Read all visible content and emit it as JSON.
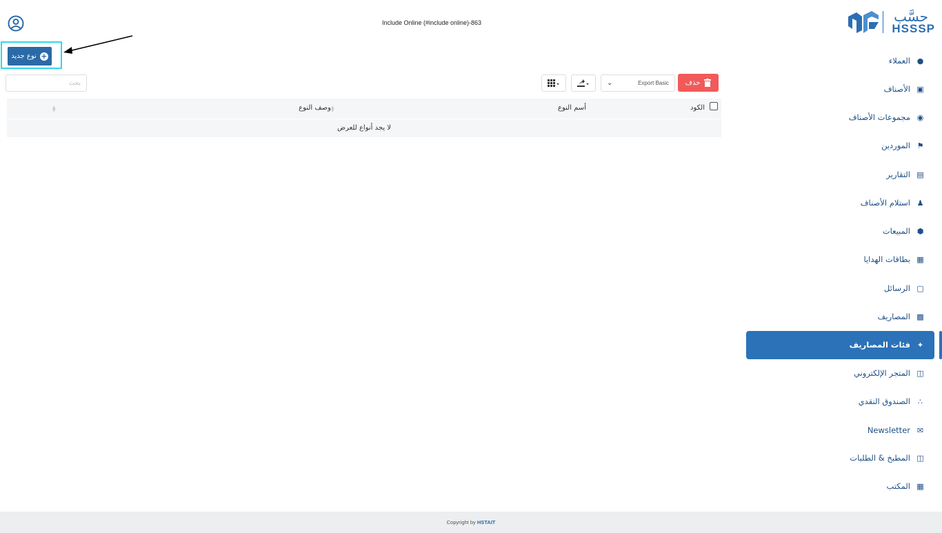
{
  "header": {
    "title": "Include Online (#include online)-863"
  },
  "logo": {
    "text_ar": "حسَّب",
    "text_en": "HSSSP"
  },
  "actions": {
    "new_type_label": "نوع جديد",
    "search_placeholder": "بحث",
    "export_select_value": "Export Basic",
    "delete_label": "حذف"
  },
  "table": {
    "columns": [
      "الكود",
      "أسم النوع",
      "وصف النوع"
    ],
    "empty_message": "لا يجد أنواع للعرض"
  },
  "sidebar": {
    "items": [
      {
        "label": "العملاء",
        "icon": "users-icon"
      },
      {
        "label": "الأصناف",
        "icon": "box-icon"
      },
      {
        "label": "مجموعات الأصناف",
        "icon": "circle-dot-icon"
      },
      {
        "label": "الموردين",
        "icon": "supplier-icon"
      },
      {
        "label": "التقارير",
        "icon": "report-icon"
      },
      {
        "label": "استلام الأصناف",
        "icon": "people-icon"
      },
      {
        "label": "المبيعات",
        "icon": "sales-icon"
      },
      {
        "label": "بطاقات الهدايا",
        "icon": "gift-icon"
      },
      {
        "label": "الرسائل",
        "icon": "message-icon"
      },
      {
        "label": "المصاريف",
        "icon": "money-icon"
      },
      {
        "label": "فئات المصاريف",
        "icon": "hand-money-icon",
        "active": true
      },
      {
        "label": "المتجر الإلكتروني",
        "icon": "store-icon"
      },
      {
        "label": "الصندوق النقدي",
        "icon": "cash-icon"
      },
      {
        "label": "Newsletter",
        "icon": "newsletter-icon"
      },
      {
        "label": "المطبخ & الطلبات",
        "icon": "kitchen-icon"
      },
      {
        "label": "المكتب",
        "icon": "office-icon"
      }
    ]
  },
  "footer": {
    "prefix": "Copyright by ",
    "brand": "HSTAIT"
  },
  "colors": {
    "primary": "#2b72b8",
    "danger": "#f25a5a",
    "highlight": "#33d6e8",
    "nav_text": "#1f4f86"
  }
}
